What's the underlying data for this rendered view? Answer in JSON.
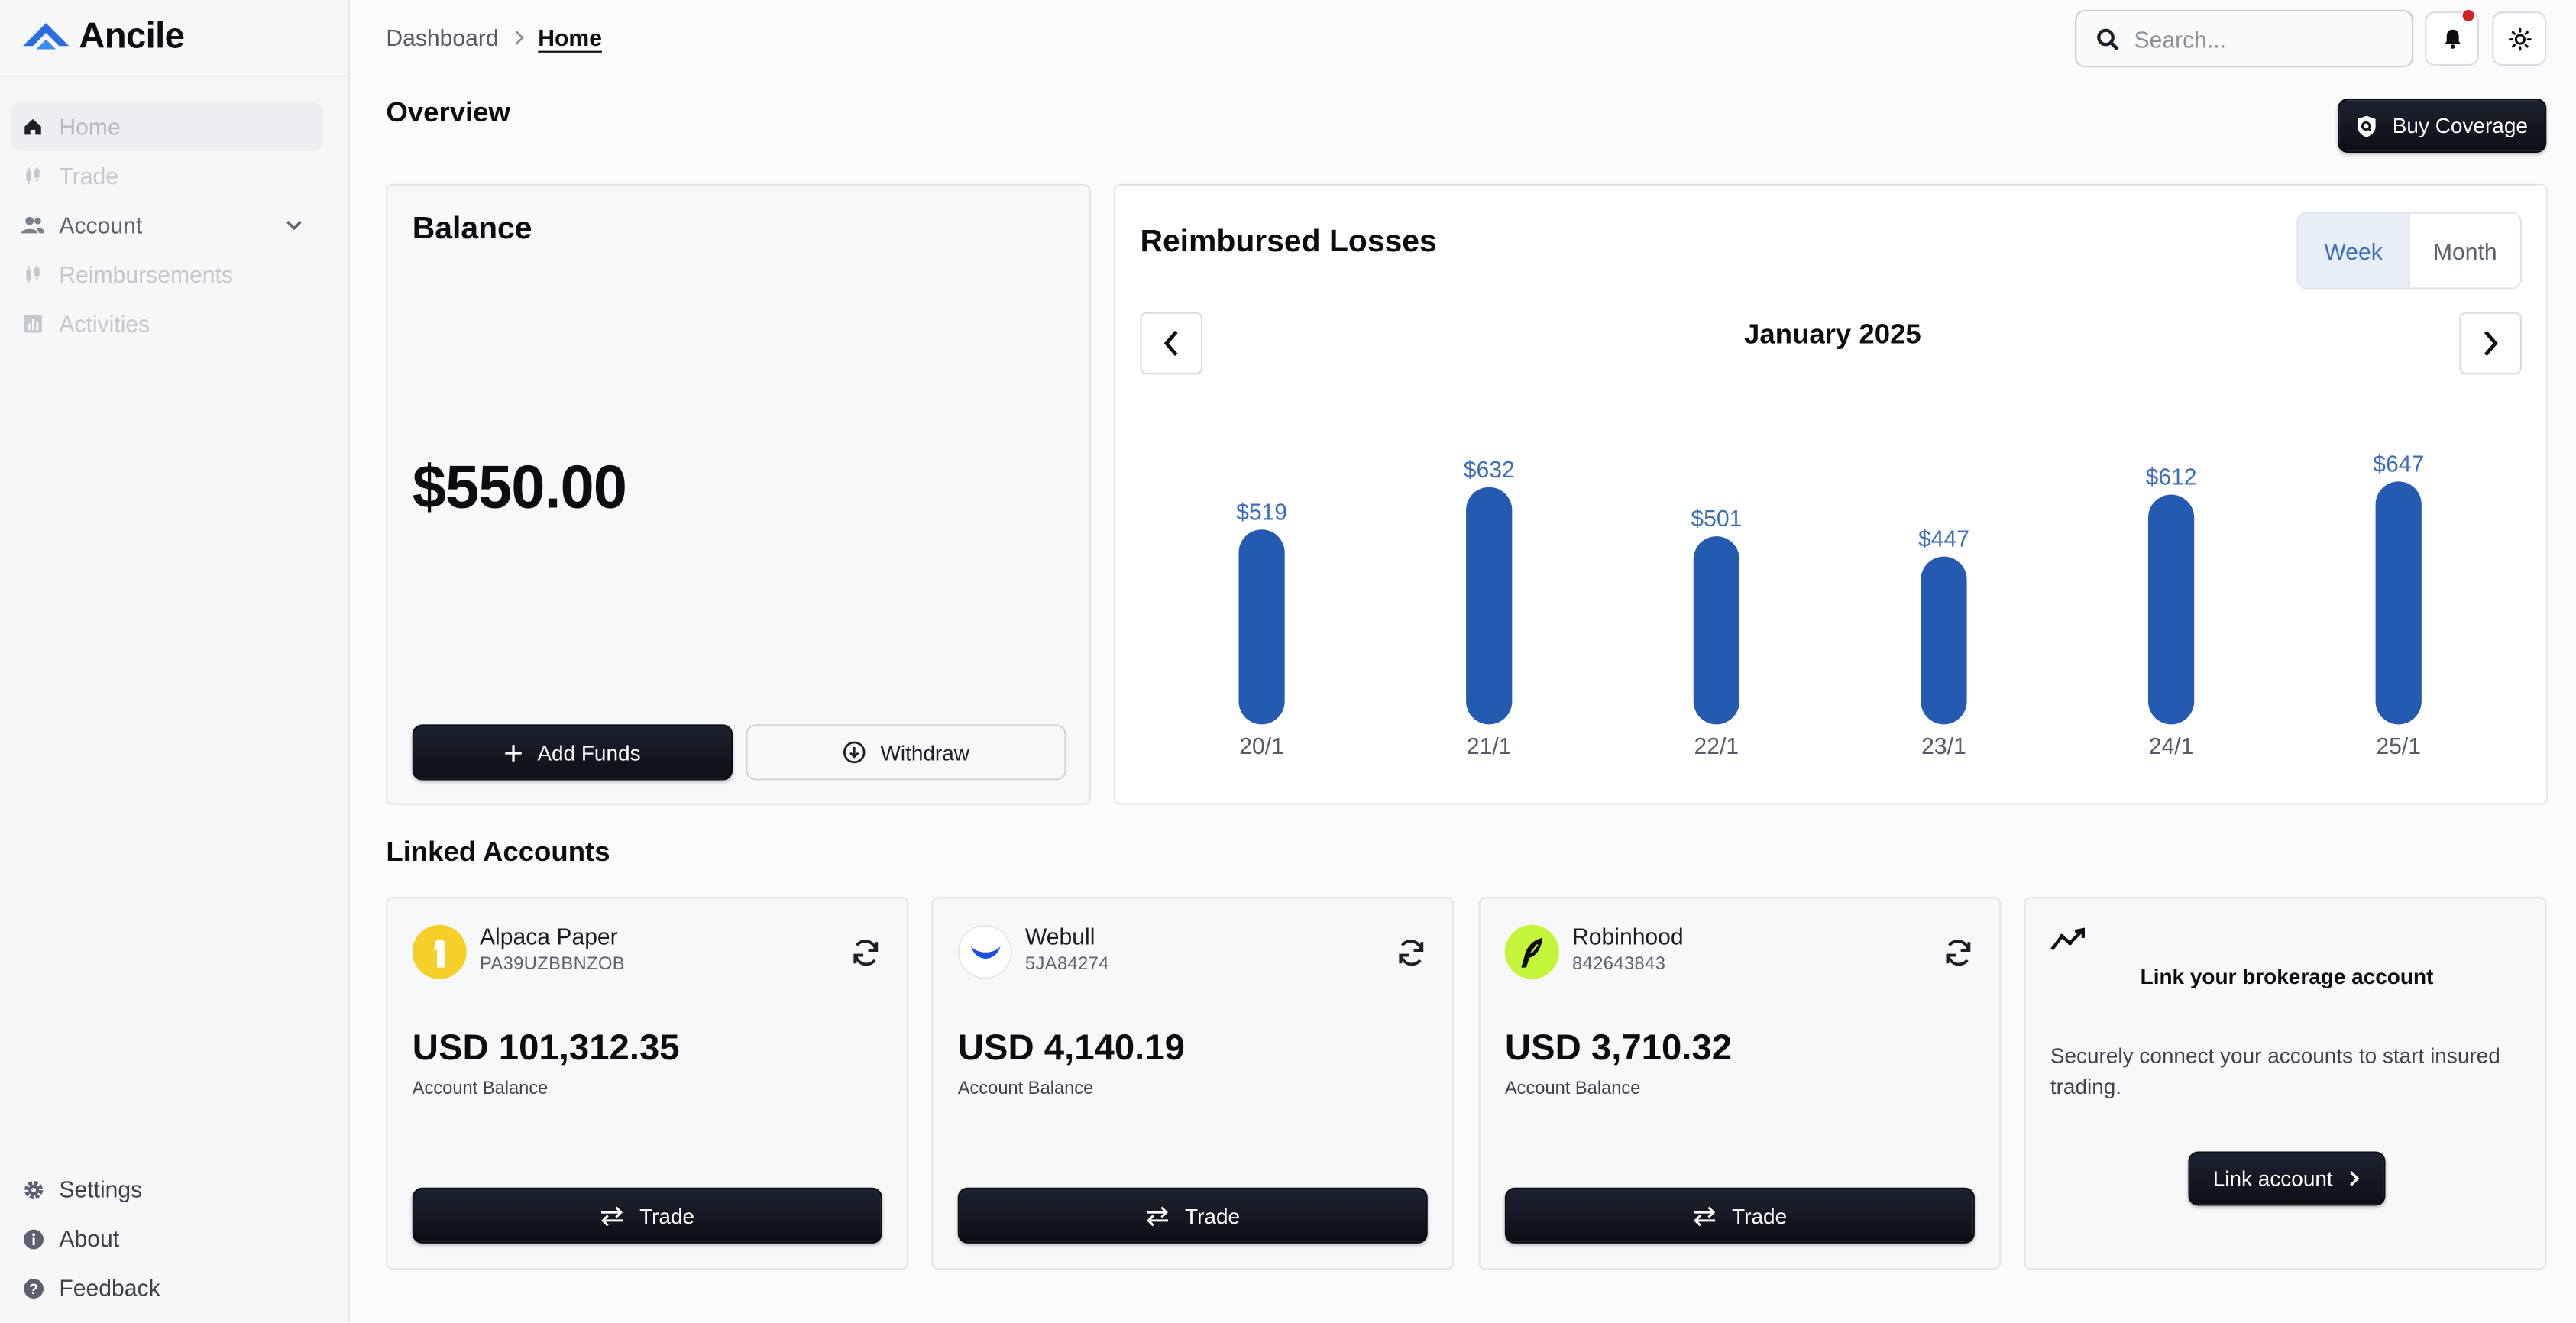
{
  "app": {
    "name": "Ancile"
  },
  "sidebar": {
    "items": [
      {
        "label": "Home",
        "icon": "home-icon"
      },
      {
        "label": "Trade",
        "icon": "candlestick-icon"
      },
      {
        "label": "Account",
        "icon": "users-icon"
      },
      {
        "label": "Reimbursements",
        "icon": "candlestick-icon"
      },
      {
        "label": "Activities",
        "icon": "bar-chart-icon"
      }
    ],
    "bottom": [
      {
        "label": "Settings",
        "icon": "gear-icon"
      },
      {
        "label": "About",
        "icon": "info-icon"
      },
      {
        "label": "Feedback",
        "icon": "help-icon"
      }
    ]
  },
  "header": {
    "breadcrumb": [
      "Dashboard",
      "Home"
    ],
    "search_placeholder": "Search..."
  },
  "page": {
    "title": "Overview",
    "buy_coverage": "Buy Coverage"
  },
  "balance": {
    "title": "Balance",
    "amount": "$550.00",
    "add_funds": "Add Funds",
    "withdraw": "Withdraw"
  },
  "reimbursed": {
    "title": "Reimbursed Losses",
    "tabs": [
      "Week",
      "Month"
    ],
    "selected_tab": "Week",
    "month": "January 2025"
  },
  "chart_data": {
    "type": "bar",
    "categories": [
      "20/1",
      "21/1",
      "22/1",
      "23/1",
      "24/1",
      "25/1"
    ],
    "values": [
      519,
      632,
      501,
      447,
      612,
      647
    ],
    "value_labels": [
      "$519",
      "$632",
      "$501",
      "$447",
      "$612",
      "$647"
    ],
    "bar_color": "#245bb0",
    "label_color": "#3d6fb8",
    "ylim": [
      0,
      700
    ],
    "grid": false,
    "title": "",
    "xlabel": "",
    "ylabel": ""
  },
  "linked": {
    "title": "Linked Accounts",
    "accounts": [
      {
        "name": "Alpaca Paper",
        "id": "PA39UZBBNZOB",
        "balance": "USD 101,312.35",
        "balance_label": "Account Balance",
        "trade": "Trade"
      },
      {
        "name": "Webull",
        "id": "5JA84274",
        "balance": "USD 4,140.19",
        "balance_label": "Account Balance",
        "trade": "Trade"
      },
      {
        "name": "Robinhood",
        "id": "842643843",
        "balance": "USD 3,710.32",
        "balance_label": "Account Balance",
        "trade": "Trade"
      }
    ],
    "link_card": {
      "title": "Link your brokerage account",
      "description": "Securely connect your accounts to start insured trading.",
      "button": "Link account"
    }
  },
  "colors": {
    "accent": "#245bb0",
    "dark_button": "#0c0f16",
    "notification": "#d22424",
    "alpaca": "#f7cf2a",
    "robinhood": "#c5f53a"
  }
}
